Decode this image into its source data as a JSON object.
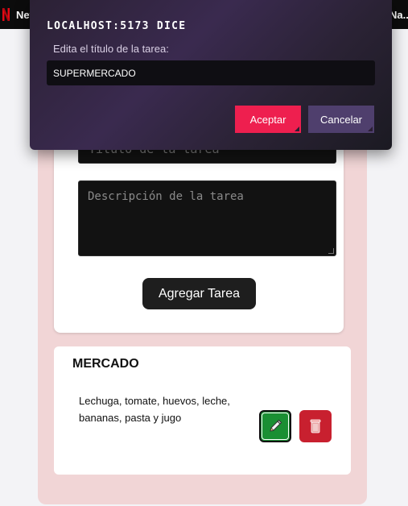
{
  "browser": {
    "bookmark_left": "Net",
    "bookmark_right": "Na..."
  },
  "form": {
    "title_placeholder": "Título de la tarea",
    "description_placeholder": "Descripción de la tarea",
    "add_button_label": "Agregar Tarea"
  },
  "task": {
    "title": "MERCADO",
    "description": "Lechuga, tomate, huevos, leche, bananas, pasta y jugo",
    "edit_icon": "pencil-icon",
    "delete_icon": "trash-icon"
  },
  "dialog": {
    "title": "LOCALHOST:5173 DICE",
    "message": "Edita el título de la tarea:",
    "input_value": "SUPERMERCADO",
    "accept_label": "Aceptar",
    "cancel_label": "Cancelar"
  },
  "colors": {
    "accept": "#ee1f4f",
    "cancel": "#4f3f6d",
    "edit": "#1a8f33",
    "delete": "#c8202f",
    "panel": "#f1d5d6"
  }
}
